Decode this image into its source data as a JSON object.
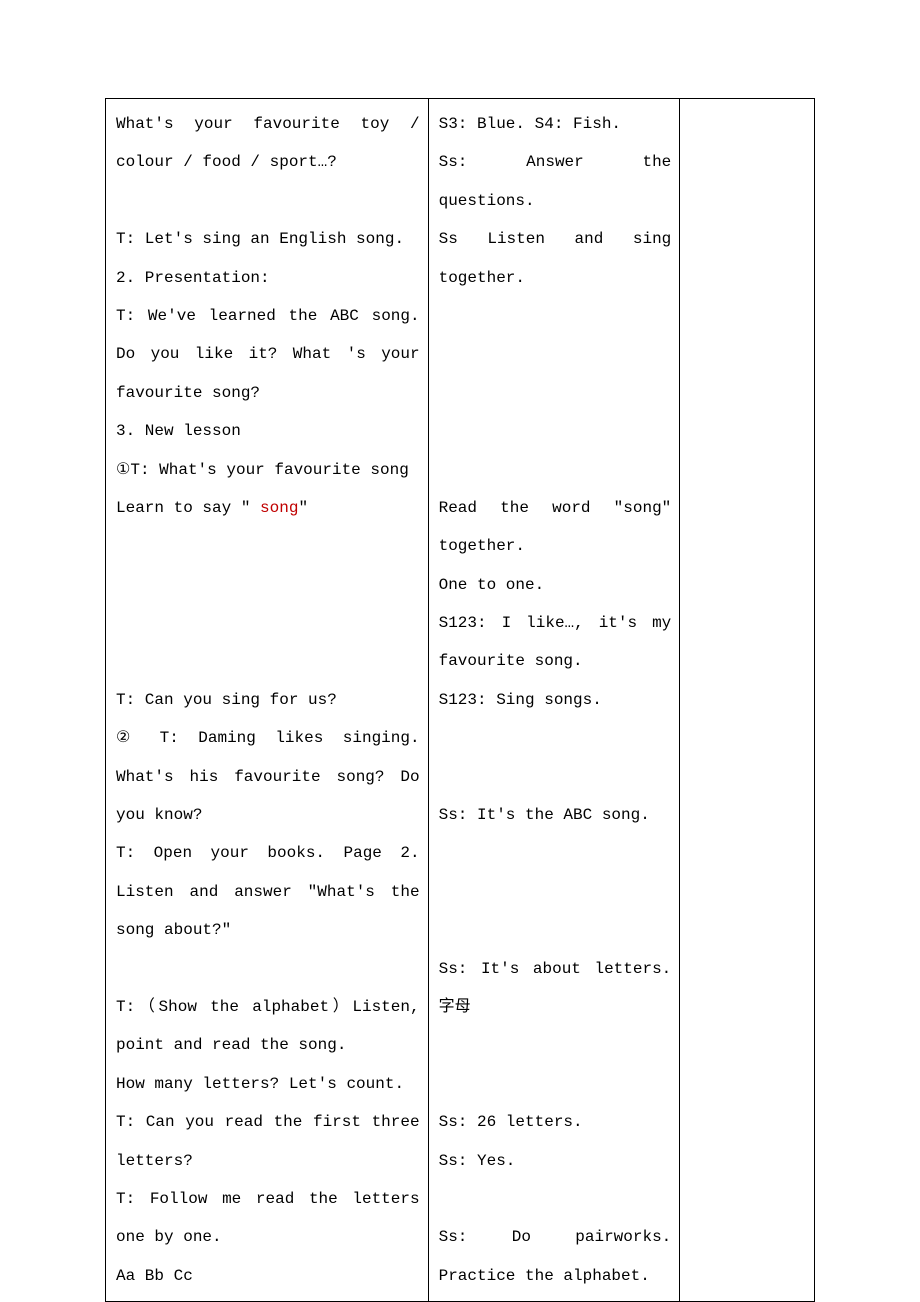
{
  "col1": {
    "p1_a": "What's your favourite toy / colour / food / sport…?",
    "p2": "T: Let's sing an English song.",
    "p3": "2.  Presentation:",
    "p4": "T: We've learned the ABC song. Do you like it? What 's your favourite song?",
    "p5": "3. New lesson",
    "p6": "①T: What's your favourite song",
    "p7_prefix": "Learn to say \" ",
    "p7_red": "song",
    "p7_suffix": "\"",
    "p8": "T: Can you sing for us?",
    "p9": "② T: Daming likes singing. What's his favourite song? Do you know?",
    "p10": "T: Open your books. Page 2. Listen and answer \"What's the song about?\"",
    "p11": "T:（Show the alphabet）Listen, point and read the song.",
    "p12": "How many letters? Let's count.",
    "p13": "T: Can you read the first three letters?",
    "p14": "T: Follow me read the letters one by one.",
    "p15": "Aa    Bb    Cc"
  },
  "col2": {
    "p1": "S3: Blue.    S4: Fish.",
    "p2": "Ss: Answer the questions.",
    "p3": "Ss Listen and sing together.",
    "p4": "Read the word \"song\" together.",
    "p5": "One to one.",
    "p6": "S123: I like…, it's my favourite song.",
    "p7": "S123: Sing songs.",
    "p8": "Ss: It's the ABC song.",
    "p9": "Ss: It's about letters. 字母",
    "p10": "Ss: 26 letters.",
    "p11": "Ss: Yes.",
    "p12": "Ss: Do pairworks. Practice the alphabet."
  }
}
